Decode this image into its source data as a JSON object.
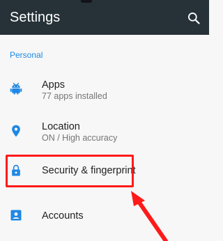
{
  "appbar": {
    "title": "Settings",
    "search_icon": "search-icon",
    "background": "#263238"
  },
  "section": {
    "header": "Personal",
    "color": "#1e88e5"
  },
  "items": [
    {
      "label": "Apps",
      "summary": "77 apps installed",
      "icon": "android-icon"
    },
    {
      "label": "Location",
      "summary": "ON / High accuracy",
      "icon": "location-pin-icon"
    },
    {
      "label": "Security & fingerprint",
      "summary": "",
      "icon": "lock-icon"
    },
    {
      "label": "Accounts",
      "summary": "",
      "icon": "account-box-icon"
    }
  ],
  "annotation": {
    "highlight_color": "#ff1a1a",
    "target": "Security & fingerprint"
  }
}
